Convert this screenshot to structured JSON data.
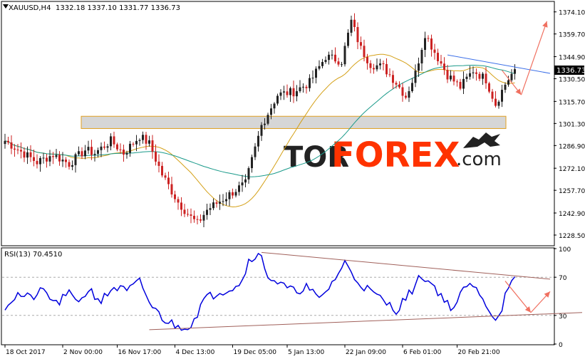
{
  "header": {
    "symbol": "XAUUSD,H4",
    "ohlc": "1332.18 1337.10 1331.77 1336.73"
  },
  "price_badge": "1336.73",
  "watermark": {
    "part1": "TOR",
    "part2": "FOREX",
    "part3": ".com"
  },
  "colors": {
    "bull": "#222222",
    "bear": "#cc2222",
    "ma_fast": "#d4a017",
    "ma_slow": "#1a9a8a",
    "rsi": "#0000dd",
    "trend": "#a0605a",
    "resistance": "#3a6ee8",
    "arrow": "#f07060",
    "zone_fill": "#d6d6d6",
    "zone_border": "#e0a020",
    "watermark_dark": "#222222",
    "watermark_accent": "#ff3300"
  },
  "chart_data": [
    {
      "type": "candlestick",
      "title": "XAUUSD,H4",
      "ylim": [
        1222,
        1380
      ],
      "yticks": [
        "1374.10",
        "1359.70",
        "1344.90",
        "1330.50",
        "1315.70",
        "1301.30",
        "1286.90",
        "1272.10",
        "1257.70",
        "1242.90",
        "1228.50"
      ],
      "xticks": [
        "18 Oct 2017",
        "2 Nov 00:00",
        "16 Nov 17:00",
        "4 Dec 13:00",
        "19 Dec 05:00",
        "5 Jan 13:00",
        "22 Jan 09:00",
        "6 Feb 01:00",
        "20 Feb 21:00"
      ],
      "close_path": [
        [
          0,
          1290
        ],
        [
          5,
          1283
        ],
        [
          10,
          1276
        ],
        [
          15,
          1281
        ],
        [
          20,
          1275
        ],
        [
          25,
          1284
        ],
        [
          28,
          1282
        ],
        [
          33,
          1290
        ],
        [
          37,
          1282
        ],
        [
          42,
          1293
        ],
        [
          45,
          1288
        ],
        [
          49,
          1268
        ],
        [
          54,
          1250
        ],
        [
          58,
          1240
        ],
        [
          60,
          1236
        ],
        [
          63,
          1245
        ],
        [
          68,
          1252
        ],
        [
          72,
          1258
        ],
        [
          75,
          1262
        ],
        [
          80,
          1300
        ],
        [
          85,
          1320
        ],
        [
          90,
          1322
        ],
        [
          95,
          1328
        ],
        [
          100,
          1345
        ],
        [
          105,
          1342
        ],
        [
          108,
          1368
        ],
        [
          111,
          1350
        ],
        [
          114,
          1340
        ],
        [
          118,
          1338
        ],
        [
          122,
          1328
        ],
        [
          125,
          1319
        ],
        [
          128,
          1334
        ],
        [
          131,
          1360
        ],
        [
          134,
          1348
        ],
        [
          138,
          1333
        ],
        [
          142,
          1325
        ],
        [
          146,
          1336
        ],
        [
          150,
          1330
        ],
        [
          153,
          1314
        ],
        [
          156,
          1327
        ],
        [
          159,
          1336.73
        ]
      ],
      "n_candles": 160,
      "moving_averages": [
        {
          "name": "fast",
          "color_key": "ma_fast",
          "period": 20
        },
        {
          "name": "slow",
          "color_key": "ma_slow",
          "period": 50
        }
      ],
      "support_zone": [
        1298,
        1306
      ],
      "resistance_line": [
        [
          138,
          1346
        ],
        [
          170,
          1334
        ]
      ],
      "forecast_arrows": [
        [
          [
            155,
            1336
          ],
          [
            161,
            1320
          ]
        ],
        [
          [
            161,
            1320
          ],
          [
            169,
            1368
          ]
        ]
      ]
    },
    {
      "type": "line",
      "title": "RSI(13) 70.4510",
      "ylim": [
        0,
        100
      ],
      "yticks": [
        "100",
        "70",
        "30",
        "0"
      ],
      "levels": [
        30,
        70
      ],
      "path": [
        [
          0,
          40
        ],
        [
          4,
          52
        ],
        [
          8,
          48
        ],
        [
          12,
          56
        ],
        [
          16,
          42
        ],
        [
          20,
          52
        ],
        [
          24,
          46
        ],
        [
          26,
          58
        ],
        [
          30,
          45
        ],
        [
          34,
          60
        ],
        [
          38,
          55
        ],
        [
          42,
          65
        ],
        [
          46,
          38
        ],
        [
          50,
          25
        ],
        [
          54,
          18
        ],
        [
          58,
          20
        ],
        [
          62,
          46
        ],
        [
          66,
          54
        ],
        [
          70,
          58
        ],
        [
          74,
          66
        ],
        [
          76,
          88
        ],
        [
          78,
          94
        ],
        [
          80,
          90
        ],
        [
          82,
          72
        ],
        [
          86,
          62
        ],
        [
          90,
          55
        ],
        [
          94,
          60
        ],
        [
          98,
          46
        ],
        [
          102,
          64
        ],
        [
          106,
          85
        ],
        [
          110,
          66
        ],
        [
          114,
          55
        ],
        [
          118,
          45
        ],
        [
          122,
          36
        ],
        [
          126,
          52
        ],
        [
          130,
          72
        ],
        [
          134,
          60
        ],
        [
          138,
          42
        ],
        [
          140,
          38
        ],
        [
          144,
          62
        ],
        [
          148,
          55
        ],
        [
          152,
          30
        ],
        [
          154,
          28
        ],
        [
          156,
          50
        ],
        [
          158,
          62
        ],
        [
          159,
          70.45
        ]
      ],
      "trend_upper": [
        [
          80,
          96
        ],
        [
          170,
          68
        ]
      ],
      "trend_lower": [
        [
          45,
          15
        ],
        [
          180,
          33
        ]
      ],
      "forecast_arrows": [
        [
          [
            156,
            66
          ],
          [
            164,
            33
          ]
        ],
        [
          [
            164,
            33
          ],
          [
            170,
            55
          ]
        ]
      ]
    }
  ]
}
